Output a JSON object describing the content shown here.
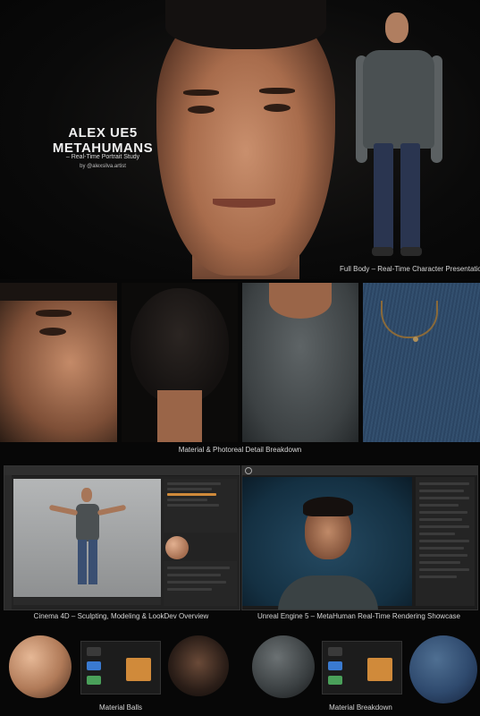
{
  "header": {
    "title_line1": "ALEX UE5",
    "title_line2": "METAHUMANS",
    "subtitle": "– Real-Time Portrait Study",
    "byline": "by @alexsilva.artist"
  },
  "captions": {
    "full_body": "Full Body – Real-Time Character Presentation",
    "detail": "Material & Photoreal Detail Breakdown",
    "cinema4d": "Cinema 4D – Sculpting, Modeling & LookDev Overview",
    "unreal": "Unreal Engine 5 – MetaHuman Real-Time Rendering Showcase",
    "material_balls": "Material Balls",
    "material_breakdown": "Material Breakdown"
  },
  "colors": {
    "background": "#070707",
    "skin": "#b9805f",
    "shirt": "#4a5052",
    "denim": "#2f4a6e",
    "ui_panel": "#232323",
    "node_orange": "#d08a3a",
    "node_blue": "#3a7ad0",
    "node_green": "#4aa05a"
  },
  "icons": {
    "unreal_logo": "unreal-logo-icon",
    "cinema_logo": "cinema4d-logo-icon"
  }
}
